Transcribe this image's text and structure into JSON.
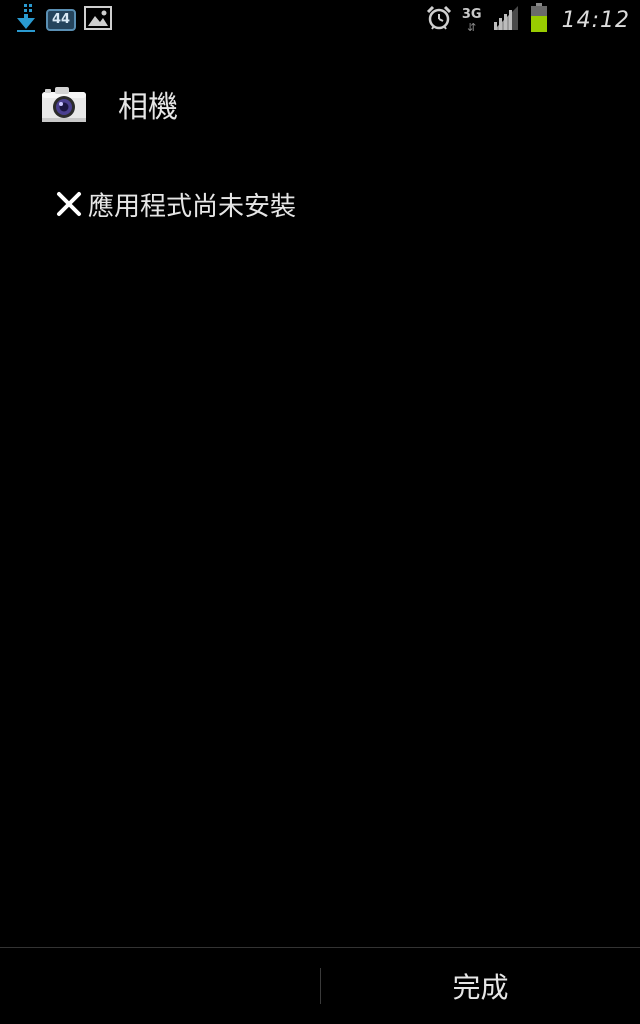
{
  "status_bar": {
    "left_icons": [
      "download-icon",
      "notification-count-icon",
      "gallery-icon"
    ],
    "notification_count": "44",
    "right_icons": [
      "alarm-icon",
      "network-type-icon",
      "signal-icon",
      "battery-icon"
    ],
    "network_type": "3G",
    "network_arrows": "⇵",
    "time": "14:12",
    "colors": {
      "download": "#2a9ad0",
      "badge_border": "#5a8fb3",
      "battery_fill": "#99cc00"
    }
  },
  "dialog": {
    "app_icon": "camera-icon",
    "app_title": "相機",
    "status_icon": "close-x-icon",
    "message": "應用程式尚未安裝"
  },
  "buttons": {
    "done_label": "完成"
  }
}
